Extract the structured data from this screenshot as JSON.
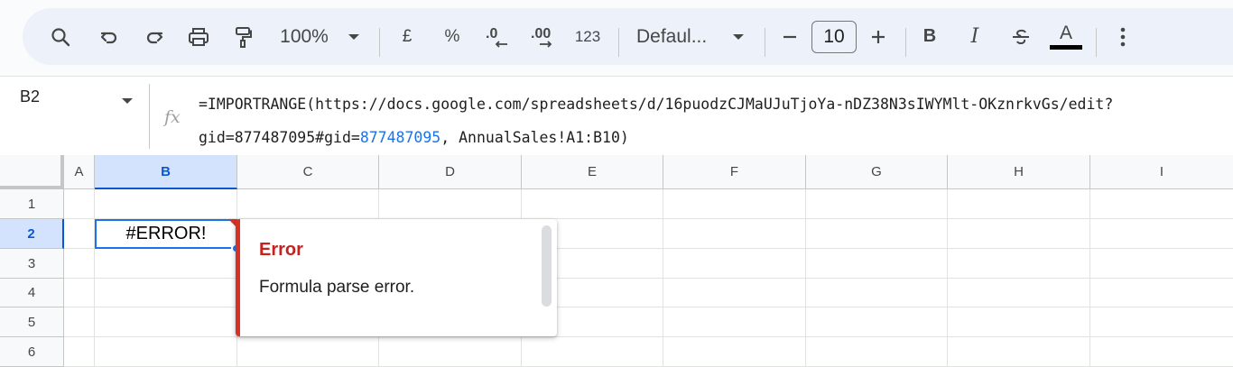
{
  "toolbar": {
    "zoom": "100%",
    "currency": "£",
    "percent": "%",
    "decrease_decimal": ".0",
    "increase_decimal": ".00",
    "number_format": "123",
    "font": "Defaul...",
    "font_size": "10",
    "bold": "B",
    "italic": "I",
    "text_color": "A",
    "icons": [
      "search-icon",
      "undo-icon",
      "redo-icon",
      "print-icon",
      "paint-format-icon",
      "chevron-down-icon",
      "minus-icon",
      "plus-icon",
      "strikethrough-icon",
      "more-vert-icon"
    ]
  },
  "formula_bar": {
    "cell_ref": "B2",
    "fx": "fx",
    "line1": "=IMPORTRANGE(https://docs.google.com/spreadsheets/d/16puodzCJMaUJuTjoYa-nDZ38N3sIWYMlt-OKznrkvGs/edit?",
    "line2_a": "gid=877487095#gid=",
    "line2_b": "877487095",
    "line2_c": ", AnnualSales!A1:B10)"
  },
  "grid": {
    "columns": [
      "A",
      "B",
      "C",
      "D",
      "E",
      "F",
      "G",
      "H",
      "I"
    ],
    "rows": [
      "1",
      "2",
      "3",
      "4",
      "5",
      "6"
    ],
    "selected_column": "B",
    "selected_row": "2",
    "active_cell_value": "#ERROR!"
  },
  "error_popup": {
    "title": "Error",
    "message": "Formula parse error."
  },
  "colors": {
    "accent": "#1a73e8",
    "error": "#d93025",
    "toolbar_bg": "#edf2fa",
    "header_selected": "#d3e3fd"
  }
}
